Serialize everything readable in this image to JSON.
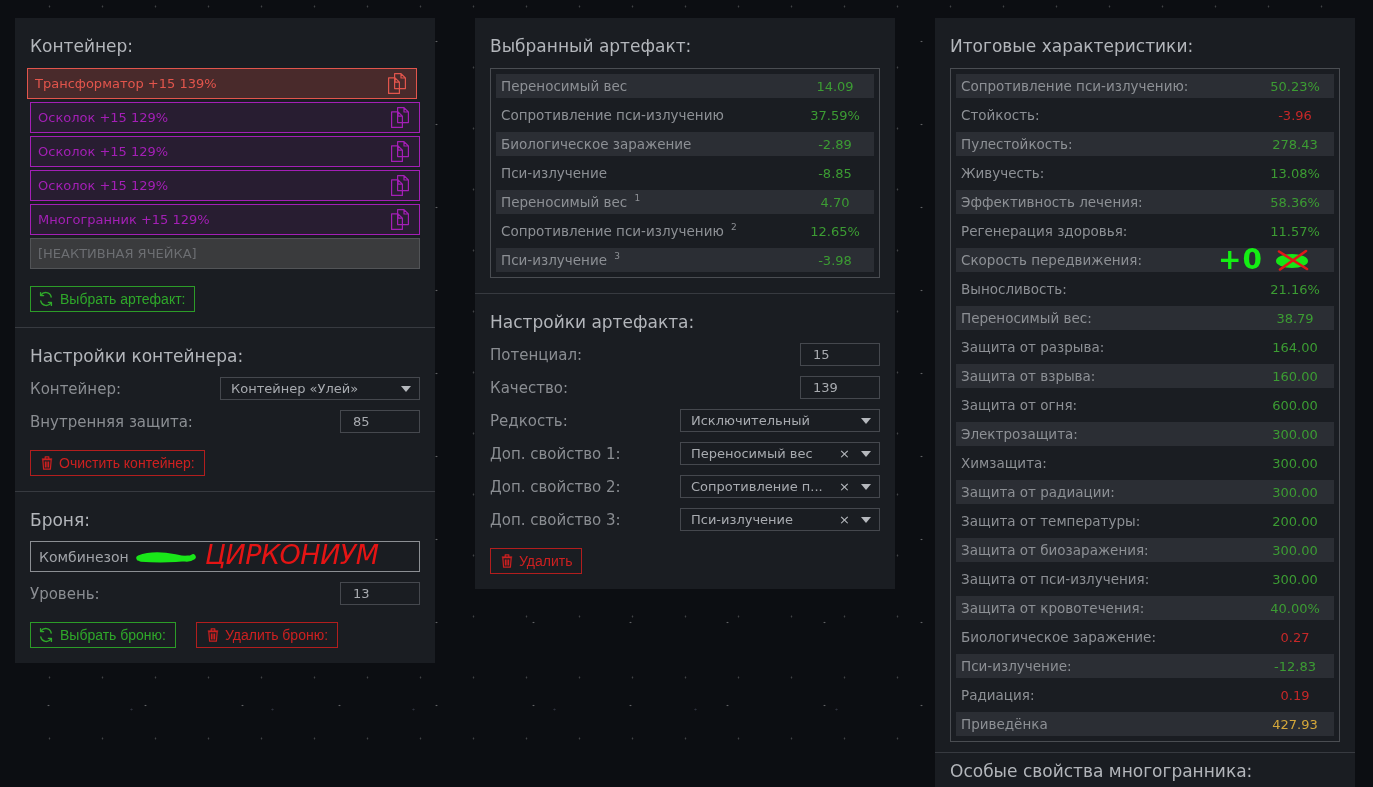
{
  "container": {
    "title": "Контейнер:",
    "slots": [
      {
        "kind": "artifact",
        "label": "Трансформатор +15 139%",
        "color": "#e2554c",
        "selected": true
      },
      {
        "kind": "artifact",
        "label": "Осколок +15 129%",
        "color": "#a41fb6",
        "selected": false
      },
      {
        "kind": "artifact",
        "label": "Осколок +15 129%",
        "color": "#a41fb6",
        "selected": false
      },
      {
        "kind": "artifact",
        "label": "Осколок +15 129%",
        "color": "#a41fb6",
        "selected": false
      },
      {
        "kind": "artifact",
        "label": "Многогранник +15 129%",
        "color": "#a41fb6",
        "selected": false
      },
      {
        "kind": "inactive",
        "label": "[НЕАКТИВНАЯ ЯЧЕЙКА]",
        "selected": false
      }
    ],
    "button": {
      "kind": "choose",
      "label": "Выбрать артефакт:"
    }
  },
  "container_settings": {
    "title": "Настройки контейнера:",
    "fields": [
      {
        "kind": "select",
        "label": "Контейнер:",
        "value": "Контейнер «Улей»"
      },
      {
        "kind": "number",
        "label": "Внутренняя защита:",
        "value": "85"
      }
    ],
    "button": {
      "kind": "remove",
      "label": "Очистить контейнер:"
    }
  },
  "armor": {
    "title": "Броня:",
    "item": {
      "value": "Комбинезон",
      "redacted": true,
      "annotation": "ЦИРКОНИУМ"
    },
    "fields": [
      {
        "kind": "number",
        "label": "Уровень:",
        "value": "13"
      }
    ],
    "buttons": [
      {
        "kind": "choose",
        "label": "Выбрать броню:"
      },
      {
        "kind": "remove",
        "label": "Удалить броню:"
      }
    ]
  },
  "selected_artifact": {
    "title": "Выбранный артефакт:",
    "stats": [
      {
        "label": "Переносимый вес",
        "value": "14.09",
        "color": "#3c9c33"
      },
      {
        "label": "Сопротивление пси-излучению",
        "value": "37.59%",
        "color": "#3c9c33"
      },
      {
        "label": "Биологическое заражение",
        "value": "-2.89",
        "color": "#3c9c33"
      },
      {
        "label": "Пси-излучение",
        "value": "-8.85",
        "color": "#3c9c33"
      },
      {
        "label": "Переносимый вес $^{1}$",
        "value": "4.70",
        "color": "#3c9c33"
      },
      {
        "label": "Сопротивление пси-излучению $^{2}$",
        "value": "12.65%",
        "color": "#3c9c33"
      },
      {
        "label": "Пси-излучение $^{3}$",
        "value": "-3.98",
        "color": "#3c9c33"
      }
    ]
  },
  "artifact_settings": {
    "title": "Настройки артефакта:",
    "fields": [
      {
        "kind": "number",
        "label": "Потенциал:",
        "value": "15"
      },
      {
        "kind": "number",
        "label": "Качество:",
        "value": "139"
      },
      {
        "kind": "select",
        "label": "Редкость:",
        "value": "Исключительный"
      },
      {
        "kind": "select",
        "label": "Доп. свойство 1:",
        "value": "Переносимый вес",
        "clear": "×"
      },
      {
        "kind": "select",
        "label": "Доп. свойство 2:",
        "value": "Сопротивление п...",
        "clear": "×"
      },
      {
        "kind": "select",
        "label": "Доп. свойство 3:",
        "value": "Пси-излучение",
        "clear": "×"
      }
    ],
    "button": {
      "kind": "remove",
      "label": "Удалить"
    }
  },
  "totals": {
    "title": "Итоговые характеристики:",
    "stats": [
      {
        "label": "Сопротивление пси-излучению:",
        "value": "50.23%",
        "color": "#3c9c33",
        "redacted": false
      },
      {
        "label": "Стойкость:",
        "value": "-3.96",
        "color": "#c62828",
        "redacted": false
      },
      {
        "label": "Пулестойкость:",
        "value": "278.43",
        "color": "#3c9c33",
        "redacted": false
      },
      {
        "label": "Живучесть:",
        "value": "13.08%",
        "color": "#3c9c33",
        "redacted": false
      },
      {
        "label": "Эффективность лечения:",
        "value": "58.36%",
        "color": "#3c9c33",
        "redacted": false
      },
      {
        "label": "Регенерация здоровья:",
        "value": "11.57%",
        "color": "#3c9c33",
        "redacted": false
      },
      {
        "label": "Скорость передвижения:",
        "redacted": true,
        "annotation": "+0"
      },
      {
        "label": "Выносливость:",
        "value": "21.16%",
        "color": "#3c9c33",
        "redacted": false
      },
      {
        "label": "Переносимый вес:",
        "value": "38.79",
        "color": "#3c9c33",
        "redacted": false
      },
      {
        "label": "Защита от разрыва:",
        "value": "164.00",
        "color": "#3c9c33",
        "redacted": false
      },
      {
        "label": "Защита от взрыва:",
        "value": "160.00",
        "color": "#3c9c33",
        "redacted": false
      },
      {
        "label": "Защита от огня:",
        "value": "600.00",
        "color": "#3c9c33",
        "redacted": false
      },
      {
        "label": "Электрозащита:",
        "value": "300.00",
        "color": "#3c9c33",
        "redacted": false
      },
      {
        "label": "Химзащита:",
        "value": "300.00",
        "color": "#3c9c33",
        "redacted": false
      },
      {
        "label": "Защита от радиации:",
        "value": "300.00",
        "color": "#3c9c33",
        "redacted": false
      },
      {
        "label": "Защита от температуры:",
        "value": "200.00",
        "color": "#3c9c33",
        "redacted": false
      },
      {
        "label": "Защита от биозаражения:",
        "value": "300.00",
        "color": "#3c9c33",
        "redacted": false
      },
      {
        "label": "Защита от пси-излучения:",
        "value": "300.00",
        "color": "#3c9c33",
        "redacted": false
      },
      {
        "label": "Защита от кровотечения:",
        "value": "40.00%",
        "color": "#3c9c33",
        "redacted": false
      },
      {
        "label": "Биологическое заражение:",
        "value": "0.27",
        "color": "#c62828",
        "redacted": false
      },
      {
        "label": "Пси-излучение:",
        "value": "-12.83",
        "color": "#3c9c33",
        "redacted": false
      },
      {
        "label": "Радиация:",
        "value": "0.19",
        "color": "#c62828",
        "redacted": false
      },
      {
        "label": "Приведёнка",
        "value": "427.93",
        "color": "#d4a73a",
        "redacted": false
      }
    ]
  },
  "polyhedron": {
    "title": "Особые свойства многогранника:"
  }
}
